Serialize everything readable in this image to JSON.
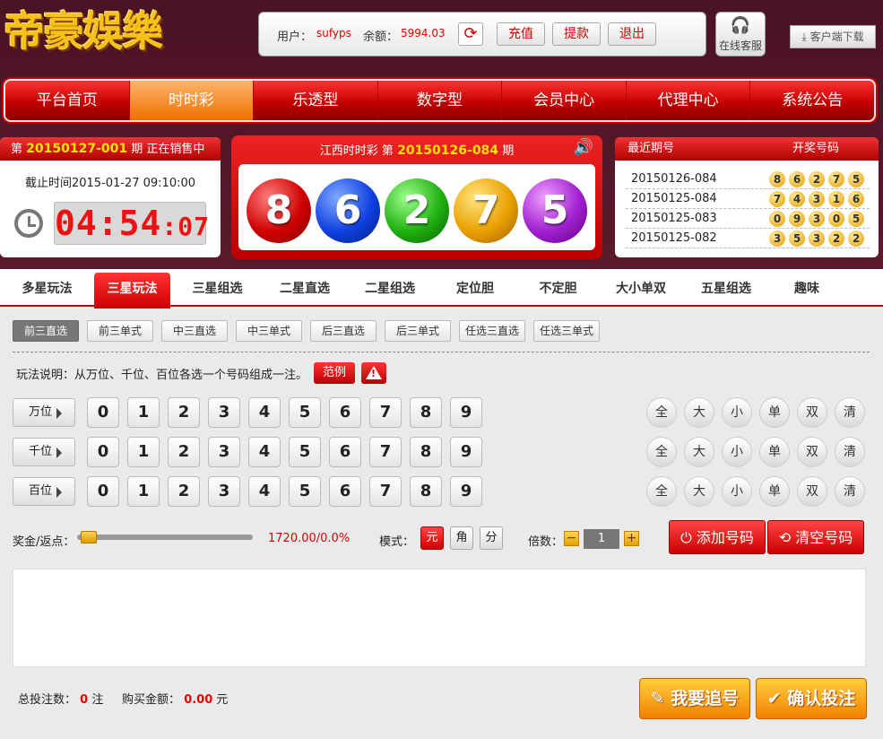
{
  "logo": "帝豪娛樂",
  "user": {
    "label": "用户：",
    "name": "sufyps",
    "balance_label": "余额：",
    "balance": "5994.03"
  },
  "top_buttons": [
    "充值",
    "提款",
    "退出"
  ],
  "cs_label": "在线客服",
  "download": "客户端下载",
  "nav": [
    "平台首页",
    "时时彩",
    "乐透型",
    "数字型",
    "会员中心",
    "代理中心",
    "系统公告"
  ],
  "current": {
    "pre": "第",
    "issue": "20150127-001",
    "post": "期 正在销售中",
    "deadline": "截止时间2015-01-27 09:10:00",
    "countdown": {
      "hm": "04:54",
      "s": ":07"
    }
  },
  "last": {
    "pre": "江西时时彩 第",
    "issue": "20150126-084",
    "post": "期",
    "balls": [
      "8",
      "6",
      "2",
      "7",
      "5"
    ]
  },
  "history": {
    "col1": "最近期号",
    "col2": "开奖号码",
    "rows": [
      {
        "issue": "20150126-084",
        "n": [
          "8",
          "6",
          "2",
          "7",
          "5"
        ]
      },
      {
        "issue": "20150125-084",
        "n": [
          "7",
          "4",
          "3",
          "1",
          "6"
        ]
      },
      {
        "issue": "20150125-083",
        "n": [
          "0",
          "9",
          "3",
          "0",
          "5"
        ]
      },
      {
        "issue": "20150125-082",
        "n": [
          "3",
          "5",
          "3",
          "2",
          "2"
        ]
      }
    ]
  },
  "tabs": [
    "多星玩法",
    "三星玩法",
    "三星组选",
    "二星直选",
    "二星组选",
    "定位胆",
    "不定胆",
    "大小单双",
    "五星组选",
    "趣味"
  ],
  "subtabs": [
    "前三直选",
    "前三单式",
    "中三直选",
    "中三单式",
    "后三直选",
    "后三单式",
    "任选三直选",
    "任选三单式"
  ],
  "rule": "玩法说明：从万位、千位、百位各选一个号码组成一注。",
  "example": "范例",
  "positions": [
    "万位",
    "千位",
    "百位"
  ],
  "digits": [
    "0",
    "1",
    "2",
    "3",
    "4",
    "5",
    "6",
    "7",
    "8",
    "9"
  ],
  "filters": [
    "全",
    "大",
    "小",
    "单",
    "双",
    "清"
  ],
  "bonus": {
    "label": "奖金/返点：",
    "value": "1720.00/0.0%",
    "level": 0.02
  },
  "mode": {
    "label": "模式：",
    "options": [
      "元",
      "角",
      "分"
    ]
  },
  "multiple": {
    "label": "倍数：",
    "minus": "−",
    "value": "1",
    "plus": "+"
  },
  "add_btn": "添加号码",
  "clear_btn": "清空号码",
  "totals": {
    "count_label": "总投注数：",
    "count": "0",
    "count_unit": "注",
    "amount_label": "购买金额：",
    "amount": "0.00",
    "amount_unit": "元"
  },
  "chase_btn": "我要追号",
  "confirm_btn": "确认投注",
  "colors": {
    "accent": "#cc0000",
    "gold": "#f6c21a",
    "orange": "#f08000"
  }
}
